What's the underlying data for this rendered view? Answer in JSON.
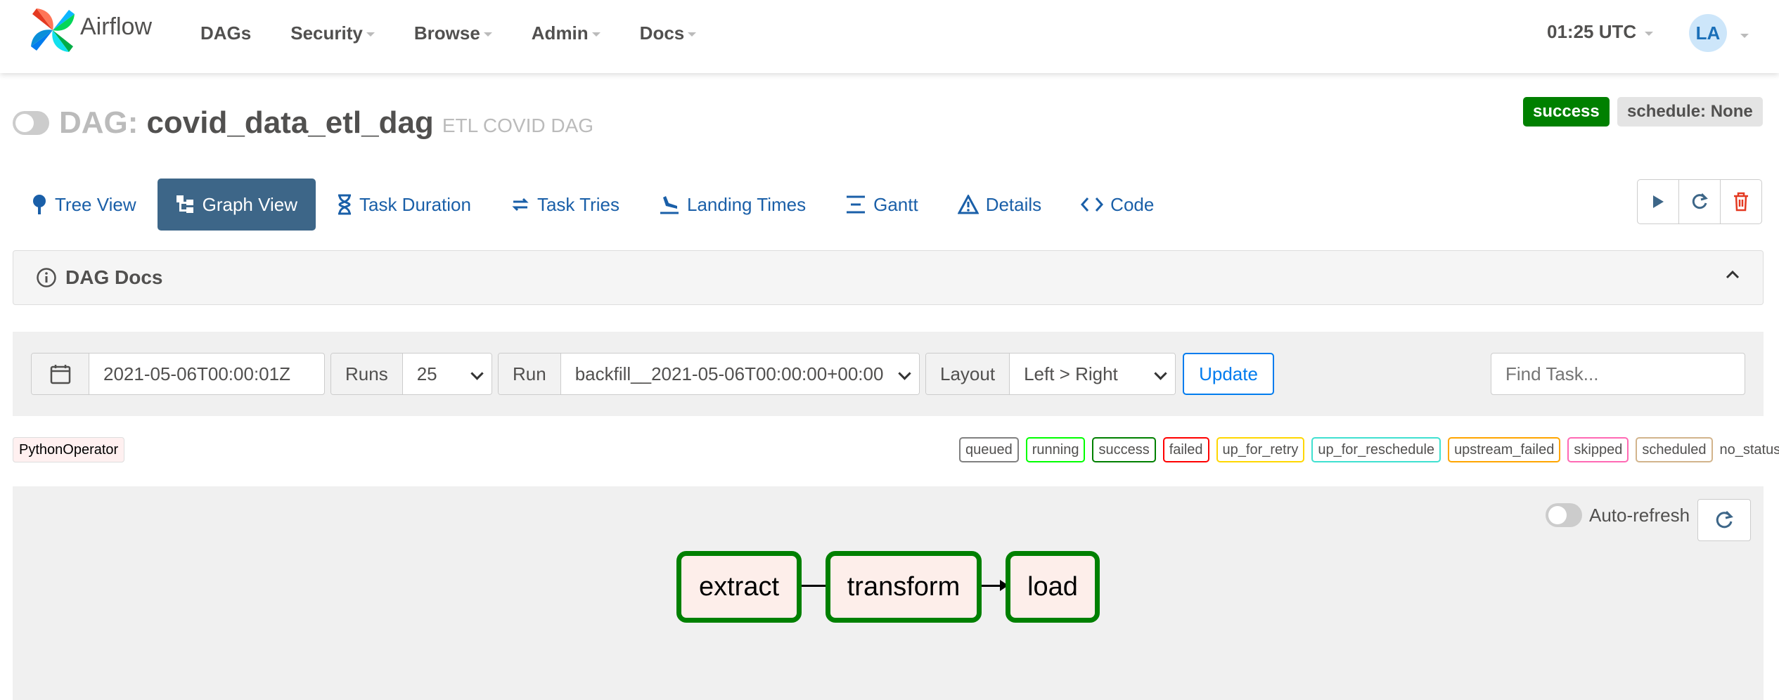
{
  "navbar": {
    "brand": "Airflow",
    "items": [
      {
        "label": "DAGs"
      },
      {
        "label": "Security"
      },
      {
        "label": "Browse"
      },
      {
        "label": "Admin"
      },
      {
        "label": "Docs"
      }
    ],
    "clock": "01:25 UTC",
    "user_initials": "LA"
  },
  "dag": {
    "label": "DAG:",
    "id": "covid_data_etl_dag",
    "description": "ETL COVID DAG",
    "status_badge": "success",
    "schedule_badge": "schedule: None"
  },
  "tabs": [
    {
      "label": "Tree View",
      "icon": "tree-icon"
    },
    {
      "label": "Graph View",
      "icon": "graph-icon",
      "active": true
    },
    {
      "label": "Task Duration",
      "icon": "hourglass-icon"
    },
    {
      "label": "Task Tries",
      "icon": "retry-icon"
    },
    {
      "label": "Landing Times",
      "icon": "landing-icon"
    },
    {
      "label": "Gantt",
      "icon": "gantt-icon"
    },
    {
      "label": "Details",
      "icon": "warning-triangle-icon"
    },
    {
      "label": "Code",
      "icon": "code-icon"
    }
  ],
  "docs": {
    "title": "DAG Docs"
  },
  "filters": {
    "date": "2021-05-06T00:00:01Z",
    "runs_label": "Runs",
    "runs_value": "25",
    "run_label": "Run",
    "run_value": "backfill__2021-05-06T00:00:00+00:00",
    "layout_label": "Layout",
    "layout_value": "Left > Right",
    "update_label": "Update",
    "find_placeholder": "Find Task..."
  },
  "legend": {
    "operator": "PythonOperator",
    "states": [
      {
        "label": "queued",
        "color": "#808080"
      },
      {
        "label": "running",
        "color": "#00ff00"
      },
      {
        "label": "success",
        "color": "#008000"
      },
      {
        "label": "failed",
        "color": "#ff0000"
      },
      {
        "label": "up_for_retry",
        "color": "#ffd700"
      },
      {
        "label": "up_for_reschedule",
        "color": "#40e0d0"
      },
      {
        "label": "upstream_failed",
        "color": "#ffa500"
      },
      {
        "label": "skipped",
        "color": "#ff69b4"
      },
      {
        "label": "scheduled",
        "color": "#d2b48c"
      },
      {
        "label": "no_status",
        "color": ""
      }
    ]
  },
  "graph": {
    "autorefresh_label": "Auto-refresh",
    "tasks": [
      {
        "label": "extract",
        "state": "success"
      },
      {
        "label": "transform",
        "state": "success"
      },
      {
        "label": "load",
        "state": "success"
      }
    ]
  },
  "colors": {
    "success": "#008000",
    "active_tab": "#3d6688",
    "link": "#017cee"
  }
}
